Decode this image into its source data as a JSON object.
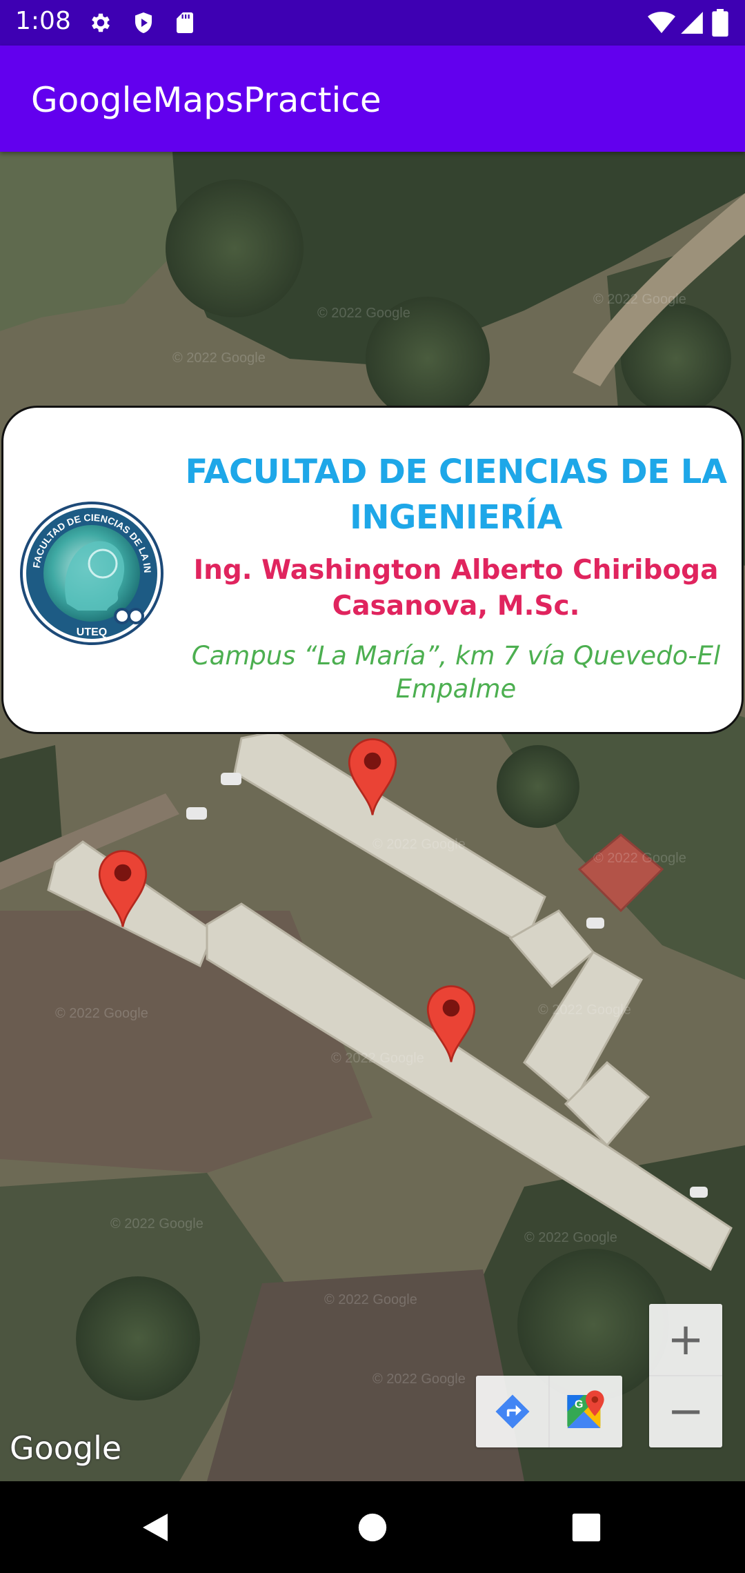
{
  "status_bar": {
    "time": "1:08",
    "icons": [
      "settings-icon",
      "shield-play-icon",
      "sd-card-icon",
      "wifi-icon",
      "signal-icon",
      "battery-icon"
    ]
  },
  "app_bar": {
    "title": "GoogleMapsPractice",
    "color": "#6200ee"
  },
  "info_window": {
    "title": "FACULTAD DE CIENCIAS DE LA INGENIERÍA",
    "name": "Ing. Washington Alberto Chiriboga Casanova, M.Sc.",
    "address": "Campus “La María”, km 7 vía Quevedo-El Empalme",
    "logo_ring_text": "FACULTAD DE CIENCIAS DE LA INGENIERIA",
    "logo_caption": "UTEQ",
    "title_color": "#1ea7e8",
    "name_color": "#e0245e",
    "address_color": "#4caf50"
  },
  "map": {
    "type": "satellite",
    "attribution": "Google",
    "markers": [
      "map-marker",
      "map-marker",
      "map-marker"
    ],
    "marker_color": "#ea4335",
    "toolbar": [
      "directions-icon",
      "google-maps-icon"
    ],
    "zoom_in_label": "+",
    "zoom_out_label": "−"
  },
  "nav_bar": {
    "buttons": [
      "back-icon",
      "home-icon",
      "recents-icon"
    ]
  }
}
